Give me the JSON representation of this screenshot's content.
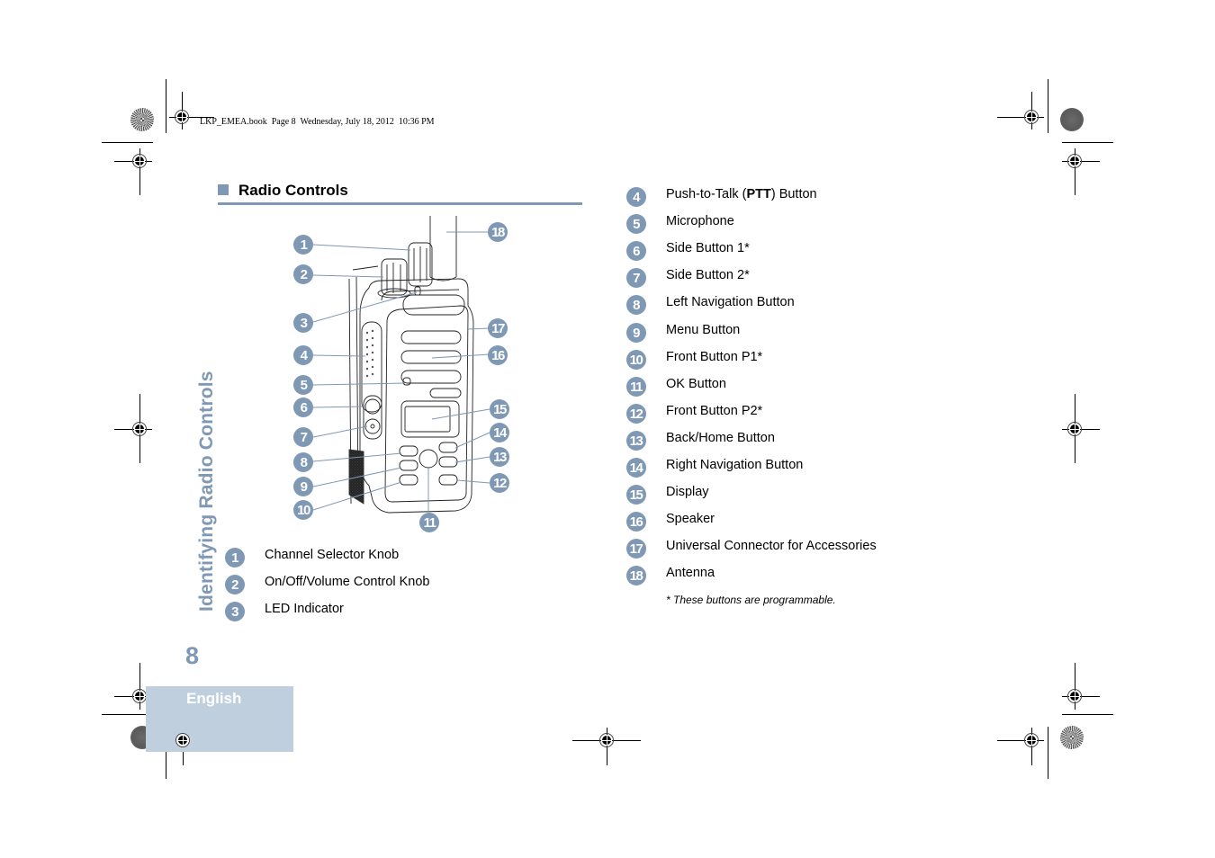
{
  "print_header": "LKP_EMEA.book  Page 8  Wednesday, July 18, 2012  10:36 PM",
  "section": {
    "title": "Radio Controls",
    "accent_color": "#7f98b4"
  },
  "side_title": "Identifying Radio Controls",
  "page_number": "8",
  "language_tab": "English",
  "diagram": {
    "name": "radio-front-view",
    "callouts": [
      "1",
      "2",
      "3",
      "4",
      "5",
      "6",
      "7",
      "8",
      "9",
      "10",
      "11",
      "12",
      "13",
      "14",
      "15",
      "16",
      "17",
      "18"
    ]
  },
  "legend_left": [
    {
      "num": "1",
      "label": "Channel Selector Knob"
    },
    {
      "num": "2",
      "label": "On/Off/Volume Control Knob"
    },
    {
      "num": "3",
      "label": "LED Indicator"
    }
  ],
  "legend_right": [
    {
      "num": "4",
      "label_pre": "Push-to-Talk (",
      "label_bold": "PTT",
      "label_post": ") Button"
    },
    {
      "num": "5",
      "label": "Microphone"
    },
    {
      "num": "6",
      "label": "Side Button 1*"
    },
    {
      "num": "7",
      "label": "Side Button 2*"
    },
    {
      "num": "8",
      "label": "Left Navigation Button"
    },
    {
      "num": "9",
      "label": "Menu Button"
    },
    {
      "num": "10",
      "label": "Front Button P1*"
    },
    {
      "num": "11",
      "label": "OK Button"
    },
    {
      "num": "12",
      "label": "Front Button P2*"
    },
    {
      "num": "13",
      "label": "Back/Home Button"
    },
    {
      "num": "14",
      "label": "Right Navigation Button"
    },
    {
      "num": "15",
      "label": "Display"
    },
    {
      "num": "16",
      "label": "Speaker"
    },
    {
      "num": "17",
      "label": "Universal Connector for Accessories"
    },
    {
      "num": "18",
      "label": "Antenna"
    }
  ],
  "footnote": "* These buttons are programmable."
}
